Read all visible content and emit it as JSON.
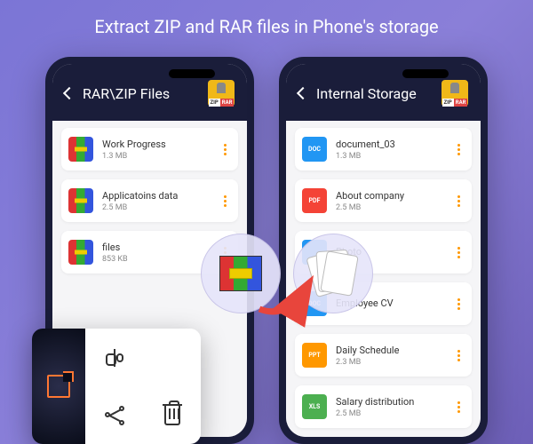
{
  "headline": "Extract ZIP and RAR files in Phone's storage",
  "phone_left": {
    "title": "RAR\\ZIP Files",
    "logo_zip": "ZIP",
    "logo_rar": "RAR",
    "files": [
      {
        "name": "Work Progress",
        "size": "1.3 MB",
        "type": "rar"
      },
      {
        "name": "Applicatoins data",
        "size": "2.5 MB",
        "type": "rar"
      },
      {
        "name": "files",
        "size": "853 KB",
        "type": "rar"
      }
    ]
  },
  "phone_right": {
    "title": "Internal Storage",
    "logo_zip": "ZIP",
    "logo_rar": "RAR",
    "files": [
      {
        "name": "document_03",
        "size": "1.3 MB",
        "type": "doc",
        "label": "DOC"
      },
      {
        "name": "About company",
        "size": "2.5 MB",
        "type": "pdf",
        "label": "PDF"
      },
      {
        "name": "Photo",
        "size": "",
        "type": "doc",
        "label": ""
      },
      {
        "name": "Employee CV",
        "size": "",
        "type": "doc",
        "label": "DOC"
      },
      {
        "name": "Daily Schedule",
        "size": "2.3 MB",
        "type": "ppt",
        "label": "PPT"
      },
      {
        "name": "Salary distribution",
        "size": "2.5 MB",
        "type": "xls",
        "label": "XLS"
      }
    ]
  },
  "actions": {
    "extract": "Extract",
    "rename": "Rename",
    "share": "Share",
    "delete": "Delete"
  }
}
